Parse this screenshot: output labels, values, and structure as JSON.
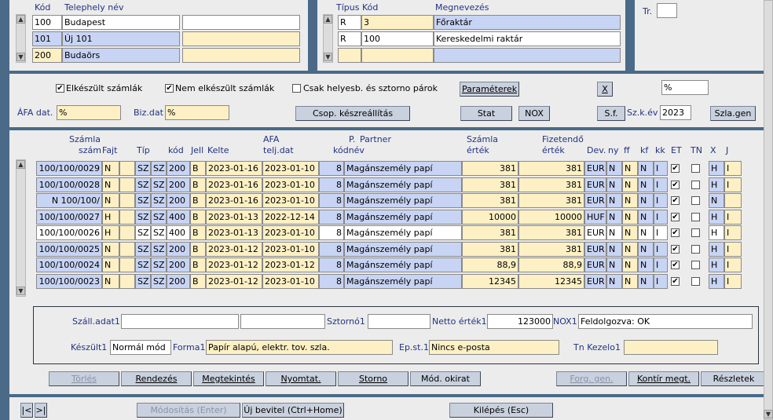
{
  "site_block": {
    "col_code": "Kód",
    "col_name": "Telephely név",
    "rows": [
      {
        "code": "100",
        "name": "Budapest",
        "extra": ""
      },
      {
        "code": "101",
        "name": "Új 101",
        "extra": ""
      },
      {
        "code": "200",
        "name": "Budaörs",
        "extra": ""
      }
    ]
  },
  "warehouse_block": {
    "col_type": "Típus",
    "col_code": "Kód",
    "col_name": "Megnevezés",
    "rows": [
      {
        "type": "R",
        "code": "3",
        "name": "Főraktár"
      },
      {
        "type": "R",
        "code": "100",
        "name": "Kereskedelmi raktár"
      },
      {
        "type": "",
        "code": "",
        "name": ""
      }
    ]
  },
  "tr": {
    "label": "Tr.",
    "value": ""
  },
  "filters": {
    "elkeszult": {
      "label": "Elkészült számlák",
      "checked": true
    },
    "nem_elkeszult": {
      "label": "Nem elkészült számlák",
      "checked": true
    },
    "csak_helyesb": {
      "label": "Csak helyesb. és sztorno párok",
      "checked": false
    },
    "parameterek": "Paraméterek",
    "x_button": "X",
    "pct_field": "%",
    "afa_dat_label": "ÁFA dat.",
    "afa_dat_value": "%",
    "biz_dat_label": "Biz.dat",
    "biz_dat_value": "%",
    "csop": "Csop. készreállítás",
    "stat": "Stat",
    "nox": "NOX",
    "sf": "S.f.",
    "szk_ev_label": "Sz.k.év",
    "szk_ev_value": "2023",
    "szla_gen": "Szla.gen"
  },
  "grid": {
    "headers": {
      "szamla_top": "Számla",
      "szamla_bottom": "szám",
      "fajt": "Fajt",
      "tip": "Típ",
      "kod": "kód",
      "jell": "Jell",
      "kelte": "Kelte",
      "afa_top": "AFA",
      "afa_bottom": "telj.dat",
      "p_top": "P.",
      "p_bottom": "kódnév",
      "partner": "Partner",
      "szamla_ertek_top": "Számla",
      "szamla_ertek_bottom": "érték",
      "fizetendo_top": "Fizetendő",
      "fizetendo_bottom": "érték",
      "dev": "Dev.",
      "ny": "ny",
      "ff": "ff",
      "kf": "kf",
      "kk": "kk",
      "et": "ET",
      "tn": "TN",
      "x": "X",
      "j": "J"
    },
    "rows": [
      {
        "szam": "100/100/0029",
        "fajt": "N",
        "f2": "",
        "tip": "SZ",
        "sz": "SZ",
        "kod": "200",
        "jell": "B",
        "kelte": "2023-01-16",
        "telj": "2023-01-10",
        "p": "8",
        "partner": "Magánszemély papí",
        "ertek": "381",
        "fiz": "381",
        "dev": "EUR",
        "ny": "N",
        "ff": "N",
        "kf": "N",
        "kk": "I",
        "et": true,
        "tn": false,
        "x": "H",
        "j": "I"
      },
      {
        "szam": "100/100/0028",
        "fajt": "N",
        "f2": "",
        "tip": "SZ",
        "sz": "SZ",
        "kod": "200",
        "jell": "B",
        "kelte": "2023-01-16",
        "telj": "2023-01-10",
        "p": "8",
        "partner": "Magánszemély papí",
        "ertek": "381",
        "fiz": "381",
        "dev": "EUR",
        "ny": "N",
        "ff": "N",
        "kf": "N",
        "kk": "I",
        "et": true,
        "tn": false,
        "x": "H",
        "j": "I"
      },
      {
        "szam": "N    100/100/",
        "fajt": "N",
        "f2": "",
        "tip": "SZ",
        "sz": "SZ",
        "kod": "200",
        "jell": "B",
        "kelte": "2023-01-16",
        "telj": "2023-01-10",
        "p": "8",
        "partner": "Magánszemély papí",
        "ertek": "381",
        "fiz": "381",
        "dev": "EUR",
        "ny": "N",
        "ff": "N",
        "kf": "N",
        "kk": "I",
        "et": true,
        "tn": false,
        "x": "N",
        "j": ""
      },
      {
        "szam": "100/100/0027",
        "fajt": "H",
        "f2": "",
        "tip": "SZ",
        "sz": "SZ",
        "kod": "400",
        "jell": "B",
        "kelte": "2023-01-13",
        "telj": "2022-12-14",
        "p": "8",
        "partner": "Magánszemély papí",
        "ertek": "10000",
        "fiz": "10000",
        "dev": "HUF",
        "ny": "N",
        "ff": "N",
        "kf": "N",
        "kk": "I",
        "et": true,
        "tn": false,
        "x": "H",
        "j": "I"
      },
      {
        "szam": "100/100/0026",
        "fajt": "H",
        "f2": "",
        "tip": "SZ",
        "sz": "SZ",
        "kod": "400",
        "jell": "B",
        "kelte": "2023-01-13",
        "telj": "2023-01-10",
        "p": "8",
        "partner": "Magánszemély papí",
        "ertek": "381",
        "fiz": "381",
        "dev": "EUR",
        "ny": "N",
        "ff": "N",
        "kf": "N",
        "kk": "I",
        "et": true,
        "tn": false,
        "x": "H",
        "j": "I"
      },
      {
        "szam": "100/100/0025",
        "fajt": "N",
        "f2": "",
        "tip": "SZ",
        "sz": "SZ",
        "kod": "200",
        "jell": "B",
        "kelte": "2023-01-12",
        "telj": "2023-01-10",
        "p": "8",
        "partner": "Magánszemély papí",
        "ertek": "381",
        "fiz": "381",
        "dev": "EUR",
        "ny": "N",
        "ff": "N",
        "kf": "N",
        "kk": "I",
        "et": true,
        "tn": false,
        "x": "H",
        "j": "I"
      },
      {
        "szam": "100/100/0024",
        "fajt": "N",
        "f2": "",
        "tip": "SZ",
        "sz": "SZ",
        "kod": "200",
        "jell": "B",
        "kelte": "2023-01-12",
        "telj": "2023-01-12",
        "p": "8",
        "partner": "Magánszemély papí",
        "ertek": "88,9",
        "fiz": "88,9",
        "dev": "EUR",
        "ny": "N",
        "ff": "N",
        "kf": "N",
        "kk": "I",
        "et": true,
        "tn": false,
        "x": "H",
        "j": "I"
      },
      {
        "szam": "100/100/0023",
        "fajt": "N",
        "f2": "",
        "tip": "SZ",
        "sz": "SZ",
        "kod": "200",
        "jell": "B",
        "kelte": "2023-01-12",
        "telj": "2023-01-10",
        "p": "8",
        "partner": "Magánszemély papí",
        "ertek": "12345",
        "fiz": "12345",
        "dev": "EUR",
        "ny": "N",
        "ff": "N",
        "kf": "N",
        "kk": "I",
        "et": true,
        "tn": false,
        "x": "H",
        "j": "I"
      }
    ]
  },
  "detail": {
    "szall_label": "Száll.adat1",
    "szall_value": "",
    "szall_value2": "",
    "sztorno_label": "Sztornó1",
    "sztorno_value": "",
    "netto_label": "Netto érték1",
    "netto_value": "123000",
    "nox_label": "NOX1",
    "nox_value": "Feldolgozva:  OK",
    "keszult_label": "Készült1",
    "keszult_value": "Normál mód",
    "forma_label": "Forma1",
    "forma_value": "Papír alapú, elektr. tov. szla.",
    "ep_label": "Ep.st.1",
    "ep_value": "Nincs e-posta",
    "tn_label": "Tn Kezelo1",
    "tn_value": ""
  },
  "actions": {
    "torles": "Törlés",
    "rendezes": "Rendezés",
    "megtekintes": "Megtekintés",
    "nyomtat": "Nyomtat.",
    "storno": "Storno",
    "mod_okirat": "Mód. okirat",
    "forg_gen": "Forg. gen.",
    "kontir": "Kontír megt.",
    "reszletek": "Részletek"
  },
  "footer": {
    "first": "|<",
    "last": ">|",
    "modositas": "Módosítás (Enter)",
    "uj_bevitel": "Új bevitel (Ctrl+Home)",
    "kilepes": "Kilépés (Esc)"
  }
}
